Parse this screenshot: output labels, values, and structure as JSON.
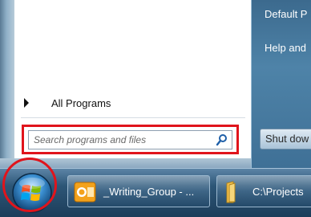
{
  "start_menu": {
    "right_items": [
      "Default P",
      "Help and"
    ],
    "all_programs_label": "All Programs",
    "search": {
      "placeholder": "Search programs and files",
      "value": ""
    },
    "shutdown_label": "Shut dow"
  },
  "taskbar": {
    "buttons": [
      {
        "label": "_Writing_Group - ...",
        "icon": "outlook-icon"
      },
      {
        "label": "C:\\Projects",
        "icon": "folder-icon"
      }
    ]
  },
  "icons": {
    "start": "windows-start-orb-icon",
    "search": "search-icon",
    "all_programs_arrow": "triangle-right-icon"
  },
  "colors": {
    "highlight": "#e0141c",
    "taskbar": "#1c3d5a",
    "right_panel": "#4e83a8"
  }
}
